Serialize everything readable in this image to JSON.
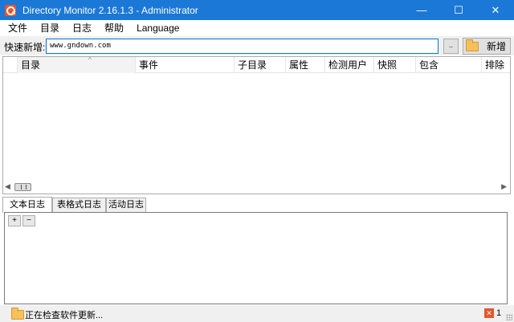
{
  "window": {
    "title": "Directory Monitor 2.16.1.3 - Administrator",
    "controls": {
      "minimize": "—",
      "maximize": "☐",
      "close": "✕"
    }
  },
  "menu": {
    "items": [
      "文件",
      "目录",
      "日志",
      "帮助",
      "Language"
    ]
  },
  "quick_add": {
    "label": "快速新增:",
    "value": "www.gndown.com",
    "browse_label": "..",
    "add_label": "新增"
  },
  "table": {
    "columns": [
      "目录",
      "事件",
      "子目录",
      "属性",
      "检测用户",
      "快照",
      "包含",
      "排除"
    ],
    "sort_indicator": "^",
    "rows": []
  },
  "tabs": [
    "文本日志",
    "表格式日志",
    "活动日志"
  ],
  "log_toolbar": {
    "expand": "+",
    "collapse": "−"
  },
  "status": {
    "text": "正在检查软件更新...",
    "error_count": "1"
  },
  "colors": {
    "titlebar": "#1b78d6",
    "accent": "#0078d7",
    "error": "#e05a2b"
  }
}
